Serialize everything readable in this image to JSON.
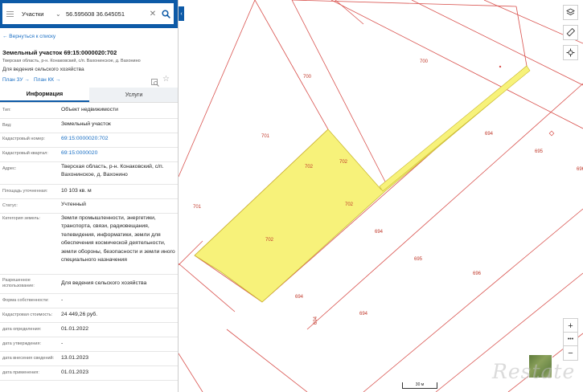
{
  "search": {
    "layer": "Участки",
    "query": "56.595608 36.645051"
  },
  "back_link": "← Вернуться к списку",
  "object": {
    "title": "Земельный участок 69:15:0000020:702",
    "address_short": "Тверская область, р-н. Конаковский, с/п. Вахонинское, д. Вахонино",
    "purpose": "Для ведения сельского хозяйства",
    "plan_zu": "План ЗУ →",
    "plan_kk": "План КК →"
  },
  "tabs": {
    "info": "Информация",
    "services": "Услуги"
  },
  "rows": [
    {
      "key": "Тип:",
      "value": "Объект недвижимости"
    },
    {
      "key": "Вид:",
      "value": "Земельный участок"
    },
    {
      "key": "Кадастровый номер:",
      "value": "69:15:0000020:702"
    },
    {
      "key": "Кадастровый квартал:",
      "value": "69:15:0000020"
    },
    {
      "key": "Адрес:",
      "value": "Тверская область, р-н. Конаковский, с/п. Вахонинское, д. Вахонино"
    },
    {
      "key": "Площадь уточненная:",
      "value": "10 103 кв. м"
    },
    {
      "key": "Статус:",
      "value": "Учтенный"
    },
    {
      "key": "Категория земель:",
      "value": "Земли промышленности, энергетики, транспорта, связи, радиовещания, телевидения, информатики, земли для обеспечения космической деятельности, земли обороны, безопасности и земли иного специального назначения"
    },
    {
      "key": "Разрешенное использование:",
      "value": "Для ведения сельского хозяйства"
    },
    {
      "key": "Форма собственности:",
      "value": "-"
    },
    {
      "key": "Кадастровая стоимость:",
      "value": "24 449,26 руб."
    },
    {
      "key": "дата определения:",
      "value": "01.01.2022"
    },
    {
      "key": "дата утверждения:",
      "value": "-"
    },
    {
      "key": "дата внесения сведений:",
      "value": "13.01.2023"
    },
    {
      "key": "дата применения:",
      "value": "01.01.2023"
    }
  ],
  "map": {
    "labels": [
      "700",
      "700",
      "701",
      "701",
      "702",
      "702",
      "702",
      "702",
      "694",
      "694",
      "694",
      "694",
      "695",
      "695",
      "696",
      "696",
      "694"
    ],
    "scale": "30 м",
    "watermark": "Restate",
    "colors": {
      "selected_fill": "#f7f27a",
      "boundary": "#d9534f",
      "header": "#0d5aa7"
    }
  },
  "controls": {
    "zoom_in": "+",
    "more": "•••",
    "zoom_out": "−"
  }
}
